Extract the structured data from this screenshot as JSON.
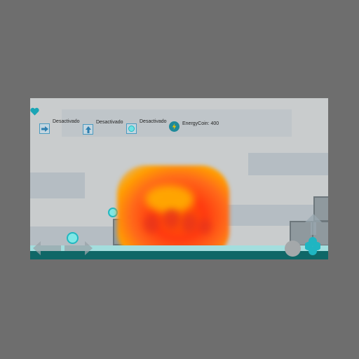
{
  "hud": {
    "powerups": [
      {
        "icon": "arrow-right-icon",
        "status": "Desactivado"
      },
      {
        "icon": "arrow-up-icon",
        "status": "Desactivado"
      },
      {
        "icon": "shield-icon",
        "status": "Desactivado"
      }
    ],
    "energy_coin": {
      "icon": "energy-coin-icon",
      "label": "EnergyCoin: 400"
    },
    "health_icon": "heart-icon"
  },
  "controls": {
    "move": "left-right-arrows",
    "jump": "up-arrow",
    "action_a": "circle-button",
    "action_b": "dpad-button"
  },
  "colors": {
    "accent": "#23b8c0",
    "floor": "#0f6767",
    "fire": "#ff4a10"
  }
}
